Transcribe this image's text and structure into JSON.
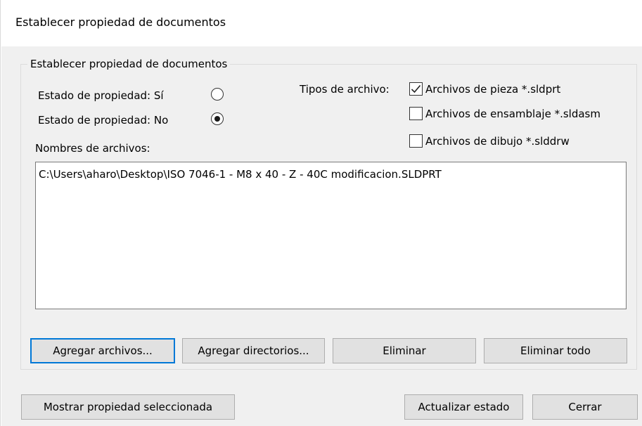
{
  "window": {
    "title": "Establecer propiedad de documentos"
  },
  "group": {
    "legend": "Establecer propiedad de documentos"
  },
  "property_state": {
    "yes_label": "Estado de propiedad: Sí",
    "no_label": "Estado de propiedad: No",
    "selected": "no"
  },
  "file_types": {
    "label": "Tipos de archivo:",
    "options": [
      {
        "label": "Archivos de pieza *.sldprt",
        "checked": true
      },
      {
        "label": "Archivos de ensamblaje *.sldasm",
        "checked": false
      },
      {
        "label": "Archivos de dibujo *.slddrw",
        "checked": false
      }
    ]
  },
  "file_names": {
    "label": "Nombres de archivos:",
    "items": [
      "C:\\Users\\aharo\\Desktop\\ISO 7046-1 - M8 x 40 - Z - 40C modificacion.SLDPRT"
    ]
  },
  "buttons": {
    "add_files": "Agregar archivos...",
    "add_dirs": "Agregar directorios...",
    "delete": "Eliminar",
    "delete_all": "Eliminar todo",
    "show_selected": "Mostrar propiedad seleccionada",
    "update_state": "Actualizar estado",
    "close": "Cerrar"
  },
  "colors": {
    "client_bg": "#f0f0f0",
    "button_bg": "#e1e1e1",
    "focus_border": "#0078d7"
  }
}
